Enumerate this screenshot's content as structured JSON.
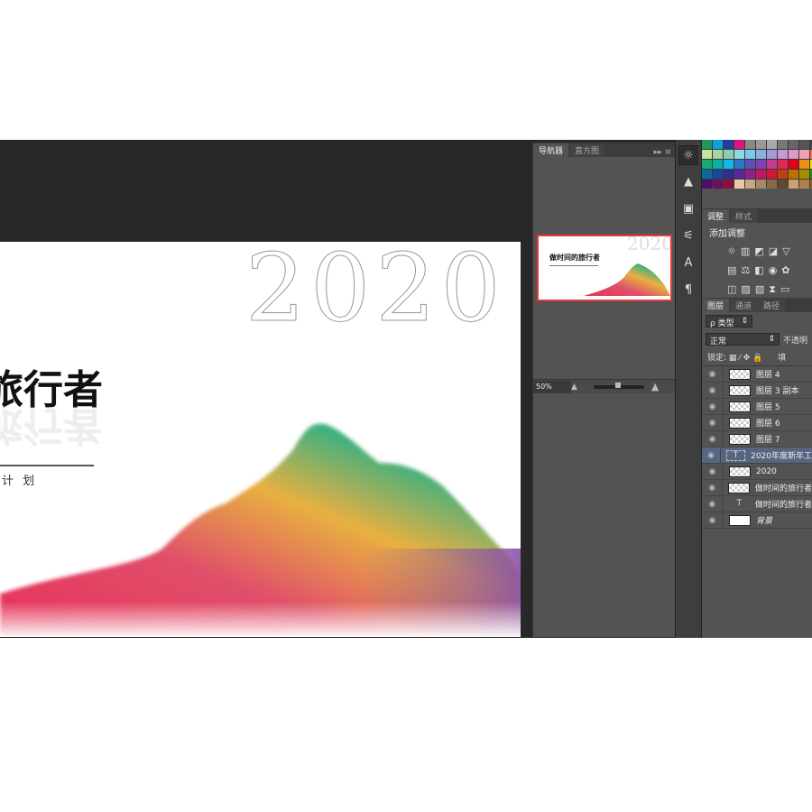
{
  "canvas": {
    "year": "2020",
    "title": "旅行者",
    "subtitle": "计 划"
  },
  "navigator": {
    "tabs": [
      "导航器",
      "直方图"
    ],
    "zoom": "50%",
    "thumb_title": "做时间的旅行者",
    "thumb_year": "2020"
  },
  "adjustments": {
    "tabs": [
      "调整",
      "样式"
    ],
    "title": "添加调整"
  },
  "layers_panel": {
    "tabs": [
      "图层",
      "通道",
      "路径"
    ],
    "filter": "ρ 类型",
    "blend": "正常",
    "opacity_label": "不透明",
    "lock_label": "锁定:",
    "fill_label": "填",
    "layers": [
      {
        "name": "图层 4",
        "thumb": "checker"
      },
      {
        "name": "图层 3 副本",
        "thumb": "checker"
      },
      {
        "name": "图层 5",
        "thumb": "checker"
      },
      {
        "name": "图层 6",
        "thumb": "checker"
      },
      {
        "name": "图层 7",
        "thumb": "checker"
      },
      {
        "name": "2020年度新年工",
        "thumb": "text",
        "selected": true
      },
      {
        "name": "2020",
        "thumb": "checker"
      },
      {
        "name": "做时间的旅行者",
        "thumb": "checker"
      },
      {
        "name": "做时间的旅行者",
        "thumb": "text-plain"
      },
      {
        "name": "背景",
        "thumb": "white"
      }
    ]
  },
  "swatches": [
    "#1c9a5a",
    "#0aa0e0",
    "#233d9c",
    "#e0147c",
    "#888",
    "#999",
    "#aaa",
    "#777",
    "#666",
    "#555",
    "#444",
    "#c7e3a0",
    "#a3d6a0",
    "#8ccfb0",
    "#8fd8e6",
    "#7fc7f0",
    "#8ab0e0",
    "#a39ad6",
    "#c59ad6",
    "#e09ac6",
    "#f0a0b8",
    "#f07850",
    "#1aa86e",
    "#0ab0a8",
    "#14b8e8",
    "#2878c8",
    "#5a50b8",
    "#8040b0",
    "#c83890",
    "#e02858",
    "#e0001a",
    "#f09010",
    "#f0e000",
    "#0a6a9a",
    "#1a4898",
    "#302c90",
    "#5a2898",
    "#90208a",
    "#c01868",
    "#d01838",
    "#c04010",
    "#c07000",
    "#a09000",
    "#208a30",
    "#4a106a",
    "#6a1060",
    "#8a1040",
    "#e8c8a8",
    "#c8a888",
    "#a88868",
    "#886848",
    "#604830",
    "#d0a070",
    "#b08050",
    "#8a6030"
  ]
}
